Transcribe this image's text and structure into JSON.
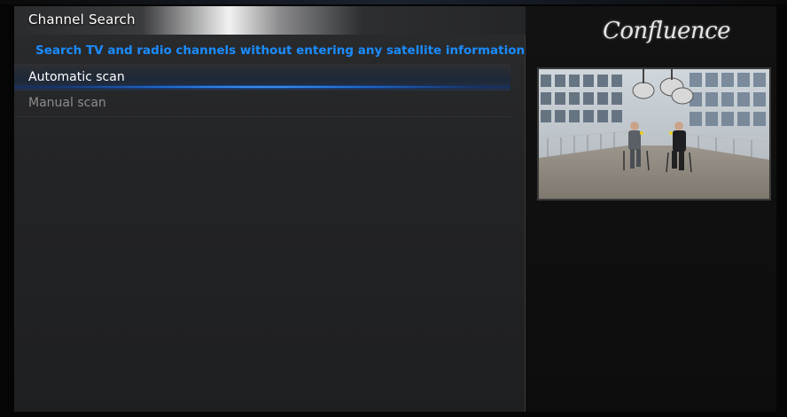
{
  "window": {
    "title": "Channel Search"
  },
  "header": {
    "subtitle": "Search TV and radio channels without entering any satellite information",
    "logo_text": "Confluence"
  },
  "menu": {
    "items": [
      {
        "label": "Automatic scan",
        "focused": true
      },
      {
        "label": "Manual scan",
        "focused": false
      }
    ]
  },
  "preview": {
    "icon": "video-preview"
  },
  "colors": {
    "accent": "#1a8cff",
    "focus_glow": "#5ab4ff",
    "text_primary": "#ffffff",
    "text_secondary": "#8c8c8c"
  }
}
